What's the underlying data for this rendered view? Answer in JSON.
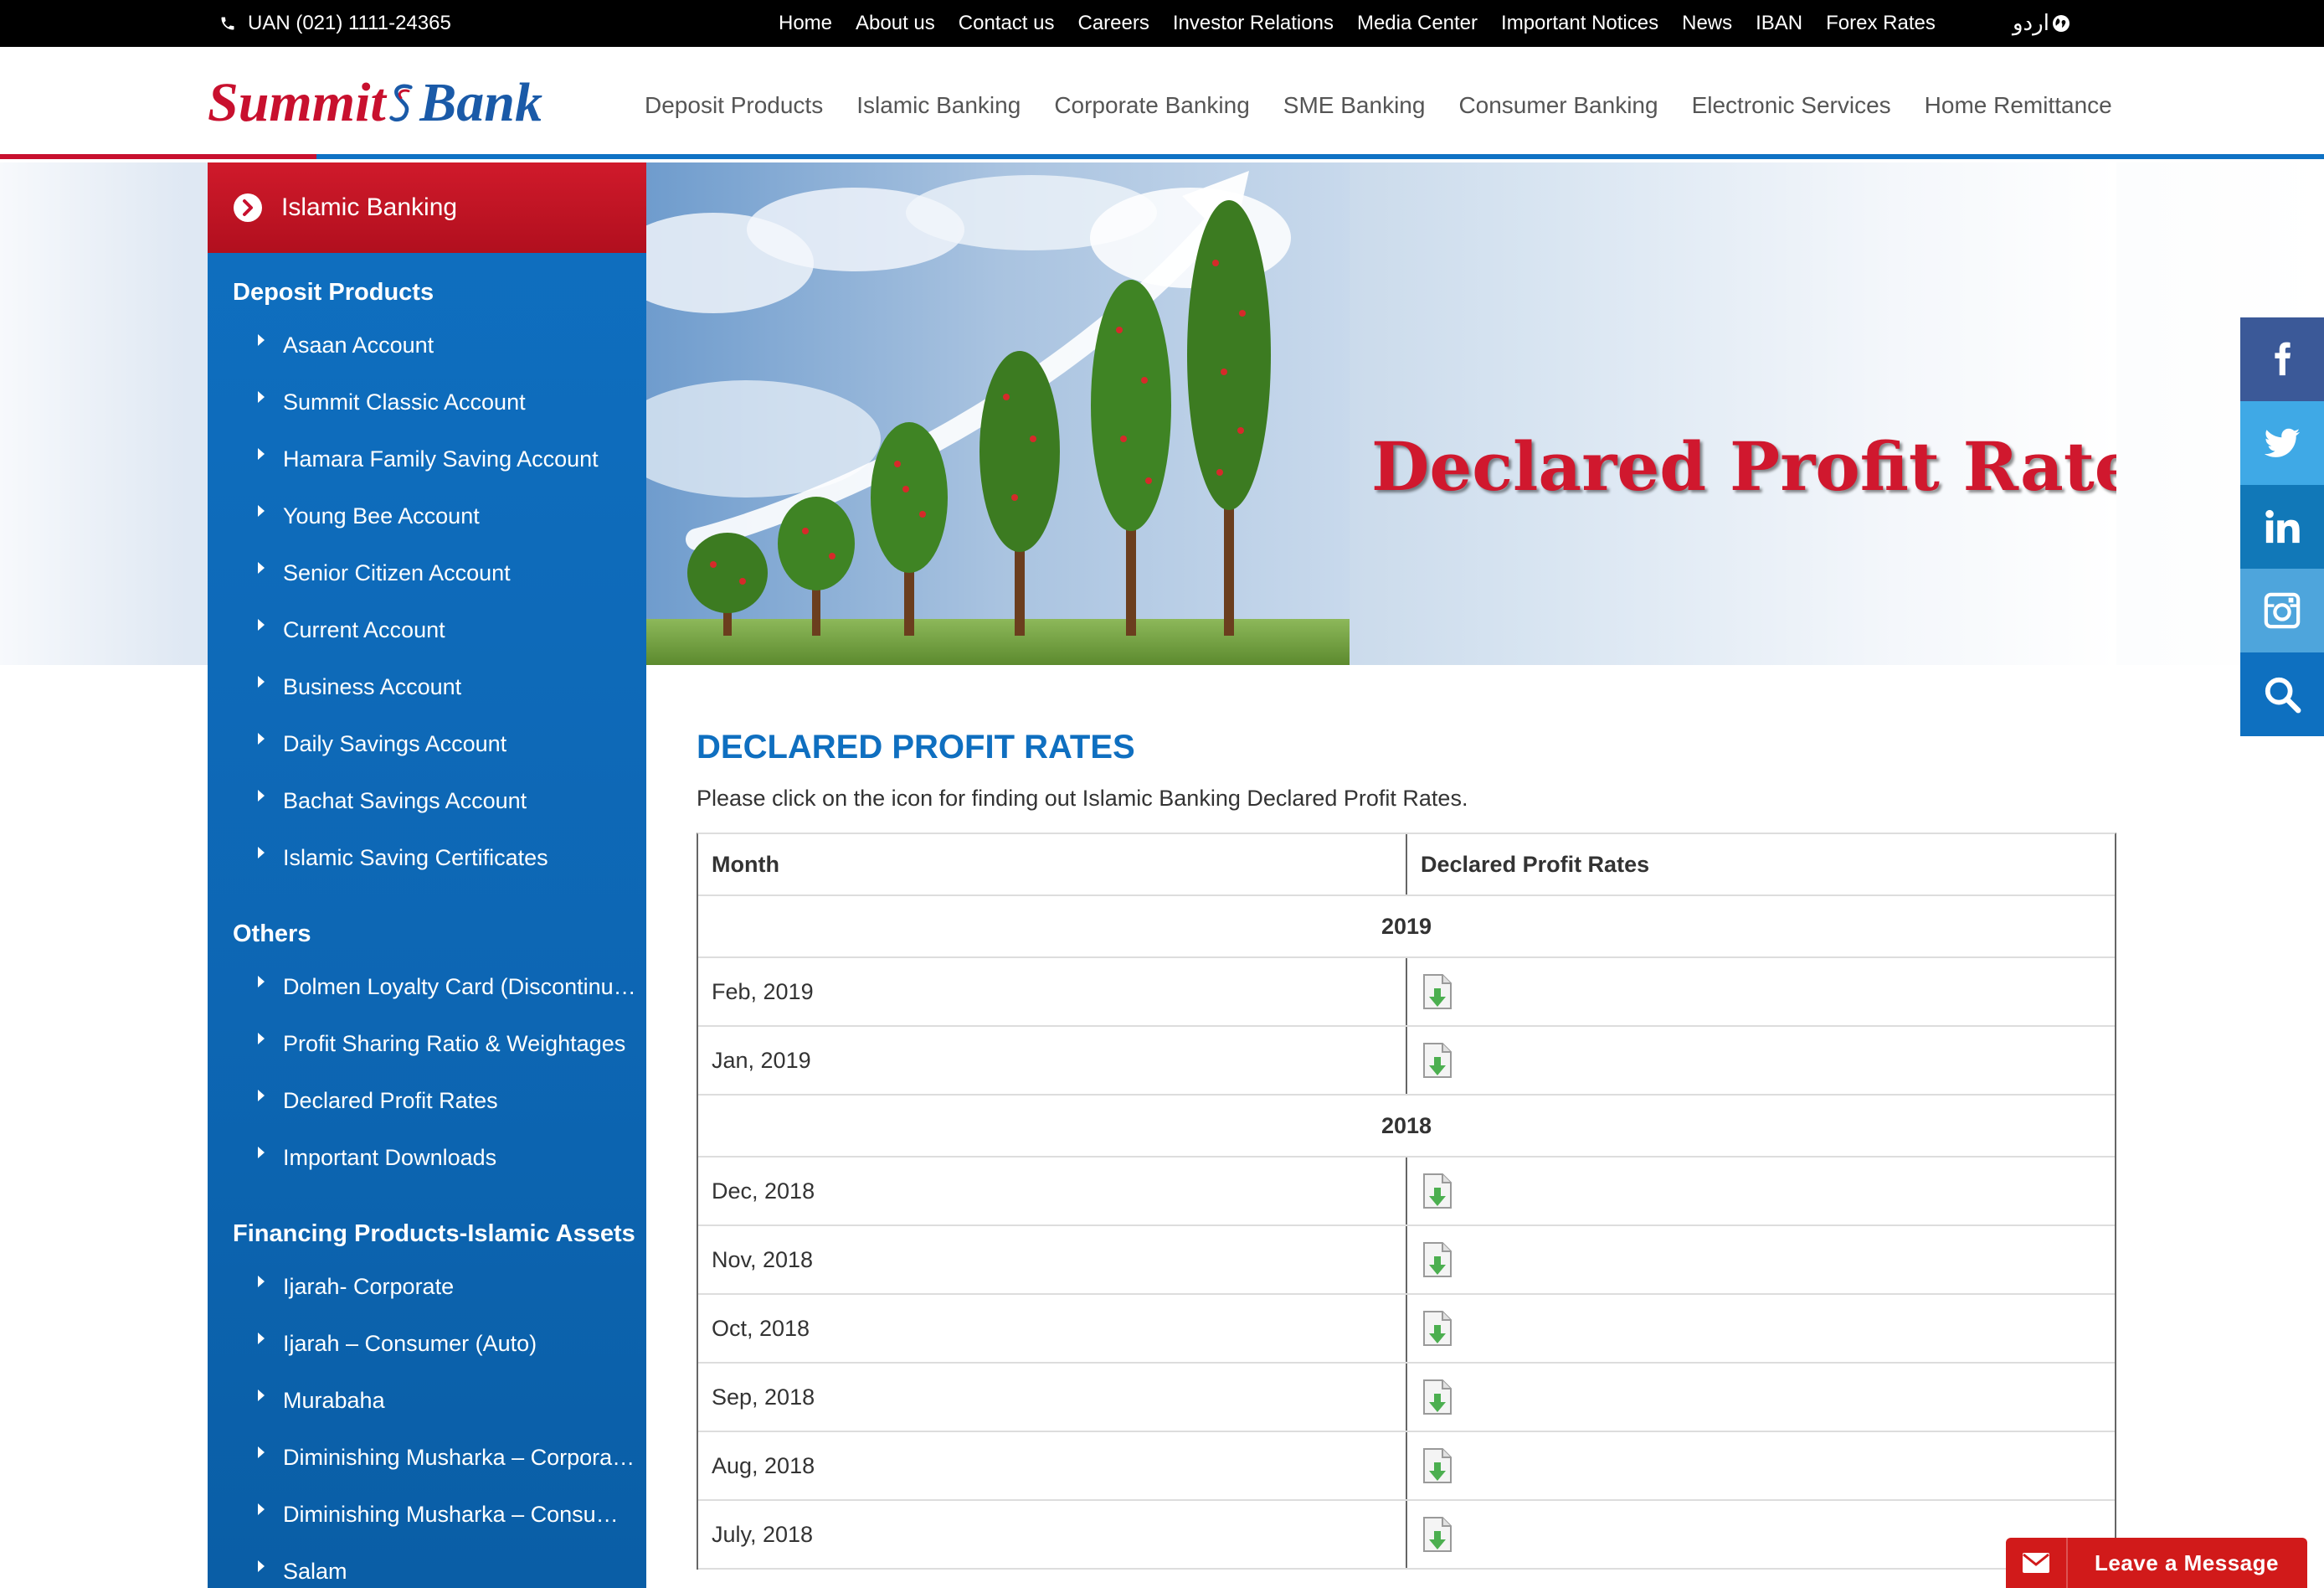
{
  "topbar": {
    "uan": "UAN (021) 1111-24365",
    "links": [
      "Home",
      "About us",
      "Contact us",
      "Careers",
      "Investor Relations",
      "Media Center",
      "Important Notices",
      "News",
      "IBAN",
      "Forex Rates"
    ],
    "language": "اردو"
  },
  "header": {
    "logo_part1": "Summit",
    "logo_part2": "Bank",
    "nav": [
      "Deposit Products",
      "Islamic Banking",
      "Corporate Banking",
      "SME Banking",
      "Consumer Banking",
      "Electronic Services",
      "Home Remittance"
    ]
  },
  "banner": {
    "headline": "Declared Profit Rates"
  },
  "sidebar": {
    "heading": "Islamic Banking",
    "sections": [
      {
        "title": "Deposit Products",
        "items": [
          "Asaan Account",
          "Summit Classic Account",
          "Hamara Family Saving Account",
          "Young Bee Account",
          "Senior Citizen Account",
          "Current Account",
          "Business Account",
          "Daily Savings Account",
          "Bachat Savings Account",
          "Islamic Saving Certificates"
        ]
      },
      {
        "title": "Others",
        "items": [
          "Dolmen Loyalty Card (Discontinu…",
          "Profit Sharing Ratio & Weightages",
          "Declared Profit Rates",
          "Important Downloads"
        ]
      },
      {
        "title": "Financing Products-Islamic Assets",
        "items": [
          "Ijarah- Corporate",
          "Ijarah – Consumer (Auto)",
          "Murabaha",
          "Diminishing Musharka – Corpora…",
          "Diminishing Musharka – Consu…",
          "Salam"
        ]
      }
    ]
  },
  "content": {
    "title": "DECLARED PROFIT RATES",
    "intro": "Please click on the icon for finding out Islamic Banking Declared Profit Rates.",
    "table": {
      "col_month": "Month",
      "col_rates": "Declared Profit Rates",
      "groups": [
        {
          "year": "2019",
          "months": [
            "Feb, 2019",
            "Jan, 2019"
          ]
        },
        {
          "year": "2018",
          "months": [
            "Dec, 2018",
            "Nov, 2018",
            "Oct, 2018",
            "Sep, 2018",
            "Aug, 2018",
            "July, 2018"
          ]
        }
      ]
    }
  },
  "social": [
    "facebook-icon",
    "twitter-icon",
    "linkedin-icon",
    "instagram-icon",
    "search-icon"
  ],
  "chat": {
    "label": "Leave a Message"
  },
  "colors": {
    "brand_red": "#c8102e",
    "brand_blue": "#0f6fc0",
    "topbar": "#000000",
    "chat_red": "#d11a1a"
  }
}
